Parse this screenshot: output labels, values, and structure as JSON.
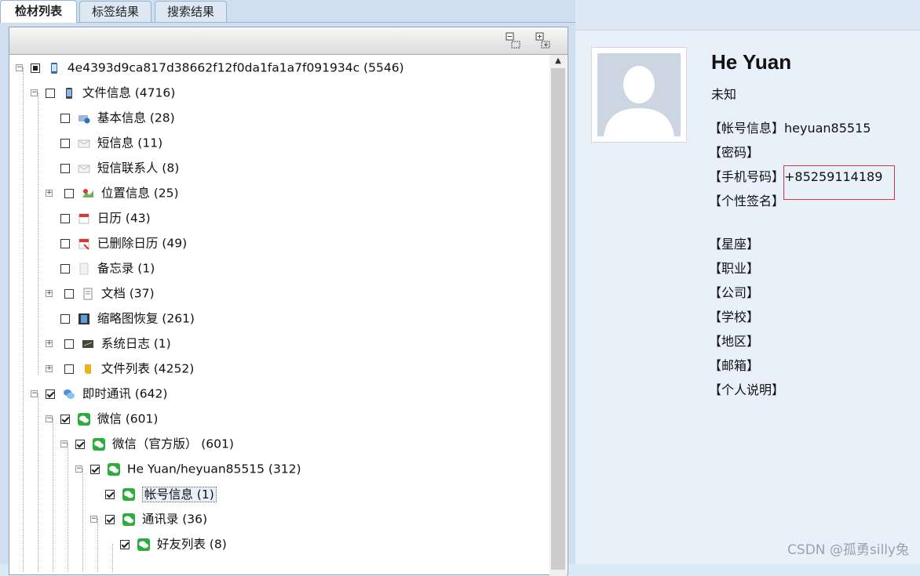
{
  "tabs": [
    "检材列表",
    "标签结果",
    "搜索结果"
  ],
  "tree": {
    "root": "4e4393d9ca817d38662f12f0da1fa1a7f091934c (5546)",
    "file_info": "文件信息 (4716)",
    "basic": "基本信息 (28)",
    "sms": "短信息 (11)",
    "sms_contacts": "短信联系人 (8)",
    "location": "位置信息 (25)",
    "calendar": "日历 (43)",
    "deleted_calendar": "已删除日历 (49)",
    "notes": "备忘录 (1)",
    "documents": "文档 (37)",
    "thumbnails": "缩略图恢复 (261)",
    "syslog": "系统日志 (1)",
    "file_list": "文件列表 (4252)",
    "im": "即时通讯 (642)",
    "wechat": "微信 (601)",
    "wechat_official": "微信（官方版） (601)",
    "account": "He Yuan/heyuan85515 (312)",
    "account_info": "帐号信息 (1)",
    "contacts": "通讯录 (36)",
    "friends": "好友列表 (8)"
  },
  "profile": {
    "name": "He Yuan",
    "gender": "未知",
    "account_label": "【帐号信息】",
    "account_value": "heyuan85515",
    "password_label": "【密码】",
    "phone_label": "【手机号码】",
    "phone_value": "+85259114189",
    "signature_label": "【个性签名】",
    "constellation_label": "【星座】",
    "job_label": "【职业】",
    "company_label": "【公司】",
    "school_label": "【学校】",
    "region_label": "【地区】",
    "email_label": "【邮箱】",
    "bio_label": "【个人说明】"
  },
  "watermark": "CSDN @孤勇silly兔",
  "colors": {
    "wechat_green": "#2aae3a",
    "highlight_box": "#d9363e"
  }
}
